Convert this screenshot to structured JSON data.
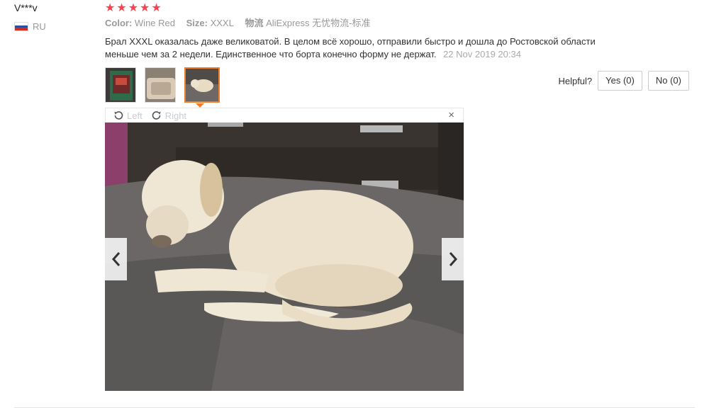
{
  "user": {
    "name": "V***v",
    "country": "RU"
  },
  "rating": {
    "stars": 5
  },
  "meta": {
    "color_key": "Color:",
    "color_val": "Wine Red",
    "size_key": "Size:",
    "size_val": "XXXL",
    "ship_key": "物流",
    "ship_val": "AliExpress 无忧物流-标准"
  },
  "review": {
    "text": "Брал XXXL оказалась даже великоватой. В целом всё хорошо, отправили быстро и дошла до Ростовской области меньше чем за 2 недели. Единственное что борта конечно форму не держат.",
    "date": "22 Nov 2019 20:34"
  },
  "helpful": {
    "label": "Helpful?",
    "yes": "Yes (0)",
    "no": "No (0)"
  },
  "viewer": {
    "left": "Left",
    "right": "Right",
    "close": "×",
    "prev": "‹",
    "next": "›"
  },
  "colors": {
    "accent": "#f17e2d",
    "star": "#f5444e"
  }
}
